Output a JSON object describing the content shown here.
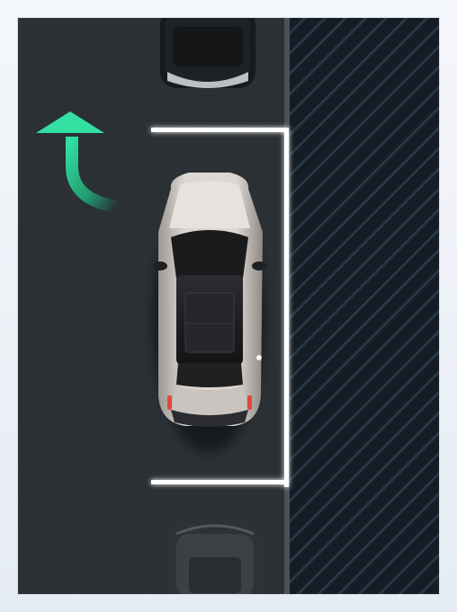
{
  "scene": {
    "name": "parking-assist-view",
    "colors": {
      "road": "#2a3034",
      "curb_zone": "#141c26",
      "hatch": "#2b3644",
      "parking_lines": "#ffffff",
      "guidance_arrow": "#2ad596",
      "ego_car_body": "#cfcac6",
      "ego_glass": "#1a1b1d",
      "neighbor_car_top": "#1e2124",
      "neighbor_car_bottom": "#2f3234"
    },
    "icons": {
      "guidance_arrow": "turn-up-arrow-icon",
      "ego_vehicle": "car-topdown-icon",
      "parked_vehicle_front": "parked-car-icon",
      "parked_vehicle_rear": "parked-car-icon"
    },
    "slot_state": "target-slot-highlighted"
  }
}
